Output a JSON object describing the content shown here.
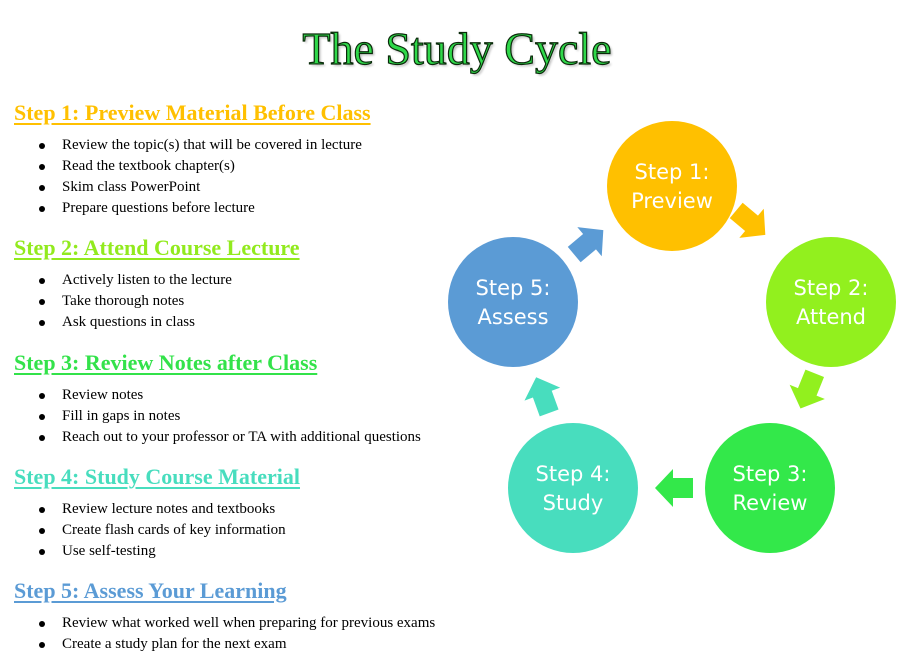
{
  "title": "The Study Cycle",
  "steps": [
    {
      "heading": "Step 1: Preview Material Before Class",
      "color": "#FFC000",
      "bullets": [
        "Review the topic(s) that will be covered in lecture",
        "Read the textbook chapter(s)",
        "Skim class PowerPoint",
        "Prepare questions before lecture"
      ]
    },
    {
      "heading": "Step 2: Attend Course Lecture",
      "color": "#92EA1E",
      "bullets": [
        "Actively listen to the lecture",
        "Take thorough notes",
        "Ask questions in class"
      ]
    },
    {
      "heading": "Step 3: Review Notes after Class",
      "color": "#33E24A",
      "bullets": [
        "Review notes",
        "Fill in gaps in notes",
        "Reach out to your professor or TA with additional questions"
      ]
    },
    {
      "heading": "Step 4: Study Course Material",
      "color": "#48DDBE",
      "bullets": [
        "Review lecture notes and textbooks",
        "Create flash cards of key information",
        "Use self-testing"
      ]
    },
    {
      "heading": "Step 5: Assess Your Learning",
      "color": "#5B9BD5",
      "bullets": [
        "Review what worked well when preparing for previous exams",
        "Create a study plan for the next exam"
      ]
    }
  ],
  "cycle": [
    {
      "line1": "Step 1:",
      "line2": "Preview",
      "color": "#FFC000"
    },
    {
      "line1": "Step 2:",
      "line2": "Attend",
      "color": "#92F01E"
    },
    {
      "line1": "Step 3:",
      "line2": "Review",
      "color": "#33E84A"
    },
    {
      "line1": "Step 4:",
      "line2": "Study",
      "color": "#48DDBE"
    },
    {
      "line1": "Step 5:",
      "line2": "Assess",
      "color": "#5B9BD5"
    }
  ]
}
